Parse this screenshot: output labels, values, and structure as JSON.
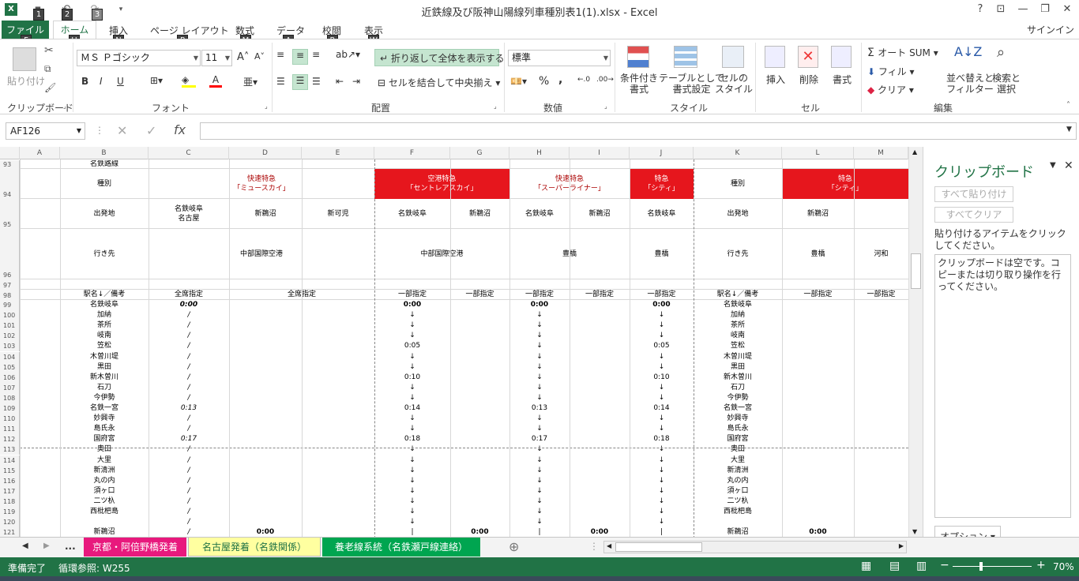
{
  "window": {
    "title": "近鉄線及び阪神山陽線列車種別表1(1).xlsx - Excel",
    "help": "?",
    "signin": "サインイン"
  },
  "qat_keytips": [
    "1",
    "2",
    "3"
  ],
  "tabs": [
    {
      "label": "ファイル",
      "key": "F"
    },
    {
      "label": "ホーム",
      "key": "H"
    },
    {
      "label": "挿入",
      "key": "N"
    },
    {
      "label": "ページ レイアウト",
      "key": "P"
    },
    {
      "label": "数式",
      "key": "M"
    },
    {
      "label": "データ",
      "key": "A"
    },
    {
      "label": "校閲",
      "key": "R"
    },
    {
      "label": "表示",
      "key": "W"
    }
  ],
  "ribbon": {
    "clipboard": {
      "paste": "貼り付け",
      "label": "クリップボード"
    },
    "font": {
      "name": "ＭＳ Ｐゴシック",
      "size": "11",
      "bold": "B",
      "italic": "I",
      "underline": "U",
      "label": "フォント"
    },
    "align": {
      "wrap": "折り返して全体を表示する",
      "merge": "セルを結合して中央揃え",
      "label": "配置"
    },
    "number": {
      "format": "標準",
      "percent": "%",
      "comma": ",",
      "label": "数値"
    },
    "styles": {
      "cond": [
        "条件付き",
        "書式"
      ],
      "table": [
        "テーブルとして",
        "書式設定"
      ],
      "cell": [
        "セルの",
        "スタイル"
      ],
      "label": "スタイル"
    },
    "cells": {
      "insert": "挿入",
      "delete": "削除",
      "format": "書式",
      "label": "セル"
    },
    "edit": {
      "autosum": "オート SUM",
      "fill": "フィル",
      "clear": "クリア",
      "sort": [
        "並べ替えと",
        "フィルター"
      ],
      "find": [
        "検索と",
        "選択"
      ],
      "label": "編集"
    }
  },
  "formula": {
    "namebox": "AF126",
    "fx": "fx"
  },
  "columns": [
    "A",
    "B",
    "C",
    "D",
    "E",
    "F",
    "G",
    "H",
    "I",
    "J",
    "K",
    "L",
    "M"
  ],
  "header_rows": {
    "r93": {
      "num": "93",
      "b": "名鉄路線"
    },
    "r94": {
      "num": "94",
      "b": "種別",
      "c": [
        "快速特急",
        "「ミュースカイ」"
      ],
      "f": [
        "空港特急",
        "「セントレアスカイ」"
      ],
      "h": [
        "快速特急",
        "「スーパーライナー」"
      ],
      "j": [
        "特急",
        "「シティ」"
      ],
      "k": "種別",
      "l": [
        "特急",
        "「シティ」"
      ]
    },
    "r95": {
      "num": "95",
      "b": "出発地",
      "c": [
        "名鉄岐阜",
        "名古屋"
      ],
      "d": "新鵜沼",
      "e": "新可児",
      "f": "名鉄岐阜",
      "g": "新鵜沼",
      "h": "名鉄岐阜",
      "i": "新鵜沼",
      "j": "名鉄岐阜",
      "k": "出発地",
      "l": "新鵜沼"
    },
    "r96": {
      "num": "96",
      "b": "行き先",
      "cd": "中部国際空港",
      "fg": "中部国際空港",
      "hi": "豊橋",
      "j": "豊橋",
      "k": "行き先",
      "l": "豊橋",
      "m": "河和"
    },
    "r97": {
      "num": "97"
    },
    "r98": {
      "num": "98",
      "b": "駅名↓／備考",
      "c": "全席指定",
      "de": "全席指定",
      "f": "一部指定",
      "g": "一部指定",
      "h": "一部指定",
      "i": "一部指定",
      "j": "一部指定",
      "k": "駅名↓／備考",
      "l": "一部指定",
      "m": "一部指定"
    }
  },
  "stations": [
    {
      "num": "99",
      "name": "名鉄岐阜",
      "c": "0:00",
      "f": "0:00",
      "h": "0:00",
      "j": "0:00"
    },
    {
      "num": "100",
      "name": "加納",
      "c": "/",
      "f": "↓",
      "h": "↓",
      "j": "↓"
    },
    {
      "num": "101",
      "name": "茶所",
      "c": "/",
      "f": "↓",
      "h": "↓",
      "j": "↓"
    },
    {
      "num": "102",
      "name": "岐南",
      "c": "/",
      "f": "↓",
      "h": "↓",
      "j": "↓"
    },
    {
      "num": "103",
      "name": "笠松",
      "c": "/",
      "f": "0:05",
      "h": "↓",
      "j": "0:05"
    },
    {
      "num": "104",
      "name": "木曽川堤",
      "c": "/",
      "f": "↓",
      "h": "↓",
      "j": "↓"
    },
    {
      "num": "105",
      "name": "黒田",
      "c": "/",
      "f": "↓",
      "h": "↓",
      "j": "↓"
    },
    {
      "num": "106",
      "name": "新木曽川",
      "c": "/",
      "f": "0:10",
      "h": "↓",
      "j": "0:10"
    },
    {
      "num": "107",
      "name": "石刀",
      "c": "/",
      "f": "↓",
      "h": "↓",
      "j": "↓"
    },
    {
      "num": "108",
      "name": "今伊勢",
      "c": "/",
      "f": "↓",
      "h": "↓",
      "j": "↓"
    },
    {
      "num": "109",
      "name": "名鉄一宮",
      "c": "0:13",
      "f": "0:14",
      "h": "0:13",
      "j": "0:14"
    },
    {
      "num": "110",
      "name": "妙興寺",
      "c": "/",
      "f": "↓",
      "h": "↓",
      "j": "↓"
    },
    {
      "num": "111",
      "name": "島氏永",
      "c": "/",
      "f": "↓",
      "h": "↓",
      "j": "↓"
    },
    {
      "num": "112",
      "name": "国府宮",
      "c": "0:17",
      "f": "0:18",
      "h": "0:17",
      "j": "0:18"
    },
    {
      "num": "113",
      "name": "奥田",
      "c": "/",
      "f": "↓",
      "h": "↓",
      "j": "↓"
    },
    {
      "num": "114",
      "name": "大里",
      "c": "/",
      "f": "↓",
      "h": "↓",
      "j": "↓"
    },
    {
      "num": "115",
      "name": "新清洲",
      "c": "/",
      "f": "↓",
      "h": "↓",
      "j": "↓"
    },
    {
      "num": "116",
      "name": "丸の内",
      "c": "/",
      "f": "↓",
      "h": "↓",
      "j": "↓"
    },
    {
      "num": "117",
      "name": "須ヶ口",
      "c": "/",
      "f": "↓",
      "h": "↓",
      "j": "↓"
    },
    {
      "num": "118",
      "name": "二ツ杁",
      "c": "/",
      "f": "↓",
      "h": "↓",
      "j": "↓"
    },
    {
      "num": "119",
      "name": "西枇杷島",
      "c": "/",
      "f": "↓",
      "h": "↓",
      "j": "↓"
    },
    {
      "num": "120",
      "name": "",
      "c": "/",
      "f": "↓",
      "h": "↓",
      "j": "↓"
    },
    {
      "num": "121",
      "name": "新鵜沼",
      "c": "/",
      "d": "0:00",
      "f": "|",
      "g": "0:00",
      "h": "|",
      "i": "0:00",
      "j": "|",
      "l": "0:00"
    }
  ],
  "clipboard_pane": {
    "title": "クリップボード",
    "paste_all": "すべて貼り付け",
    "clear_all": "すべてクリア",
    "hint": "貼り付けるアイテムをクリックしてください。",
    "empty": "クリップボードは空です。コピーまたは切り取り操作を行ってください。",
    "options": "オプション"
  },
  "sheet_tabs": [
    {
      "label": "京都・阿倍野橋発着",
      "color": "#e8197d",
      "text": "#ffffff"
    },
    {
      "label": "名古屋発着（名鉄関係）",
      "color": "#ffffa0",
      "text": "#217346"
    },
    {
      "label": "養老線系統（名鉄瀬戸線連絡）",
      "color": "#00a550",
      "text": "#ffffff"
    }
  ],
  "status": {
    "ready": "準備完了",
    "circular": "循環参照: W255",
    "zoom": "70%"
  }
}
